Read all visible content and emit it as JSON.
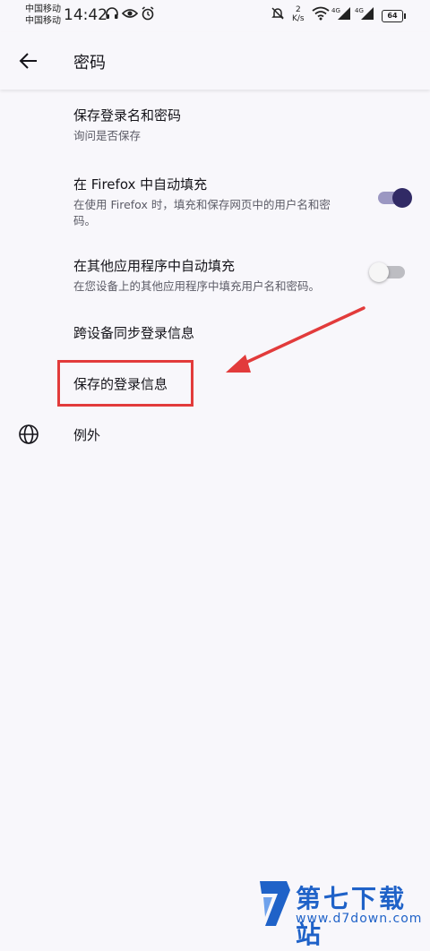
{
  "status_bar": {
    "carrier_1": "中国移动",
    "carrier_2": "中国移动",
    "time": "14:42",
    "net_speed_value": "2",
    "net_speed_unit": "K/s",
    "network_1": "4G",
    "network_2": "4G",
    "battery": "64",
    "icons": [
      "headphones-icon",
      "eye-icon",
      "alarm-icon",
      "mute-bell-icon",
      "vibrate-icon",
      "wifi-icon",
      "signal-icon"
    ]
  },
  "app_bar": {
    "title": "密码",
    "back_icon": "arrow-back-icon"
  },
  "settings": [
    {
      "title": "保存登录名和密码",
      "summary": "询问是否保存"
    },
    {
      "title": "在 Firefox 中自动填充",
      "summary": "在使用 Firefox 时，填充和保存网页中的用户名和密码。",
      "toggle_on": true
    },
    {
      "title": "在其他应用程序中自动填充",
      "summary": "在您设备上的其他应用程序中填充用户名和密码。",
      "toggle_on": false
    },
    {
      "title": "跨设备同步登录信息"
    },
    {
      "title": "保存的登录信息"
    },
    {
      "title": "例外",
      "icon": "globe-icon"
    }
  ],
  "annotation": {
    "highlight_color": "#e23b3b",
    "arrow_color": "#e23b3b"
  },
  "watermark": {
    "title": "第七下载站",
    "url": "www.d7down.com",
    "color": "#1f62c8"
  },
  "colors": {
    "background": "#f8f7fb",
    "toggle_on_thumb": "#312a65",
    "toggle_on_track": "#9b97c2"
  }
}
